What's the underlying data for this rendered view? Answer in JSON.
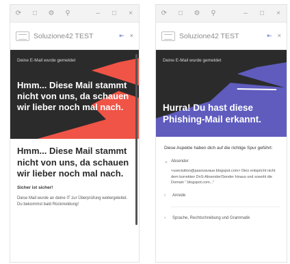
{
  "left": {
    "title": "Soluzione42 TEST",
    "status": "Deine E-Mail wurde gemeldet",
    "hero_headline": "Hmm... Diese Mail stammt nicht von uns, da schauen wir lieber noch mal nach.",
    "body_headline": "Hmm... Diese Mail stammt nicht von uns, da schauen wir lieber noch mal nach.",
    "sure": "Sicher ist sicher!",
    "message": "Diese Mail wurde an deine IT zur Überprüfung weitergeleitet. Du bekommst bald Rückmeldung!"
  },
  "right": {
    "title": "Soluzione42 TEST",
    "status": "Deine E-Mail wurde gemeldet",
    "hero_headline": "Hurra! Du hast diese Phishing-Mail erkannt.",
    "intro": "Diese Aspekte haben dich auf die richtige Spur geführt:",
    "sections": {
      "sender_label": "Absender",
      "sender_detail": "<usecisition@pasovavaue.blogspot.com> Dies entspricht nicht dem korrekten DnS-Absender/Sender hinaus und sowohl die Domain \".blogspot.com...\"",
      "attachment_label": "Anrede",
      "language_label": "Sprache, Rechtschreibung und Grammatik"
    }
  },
  "colors": {
    "red": "#ef5446",
    "purple": "#5f5cbe",
    "dark": "#2b2b2b"
  }
}
